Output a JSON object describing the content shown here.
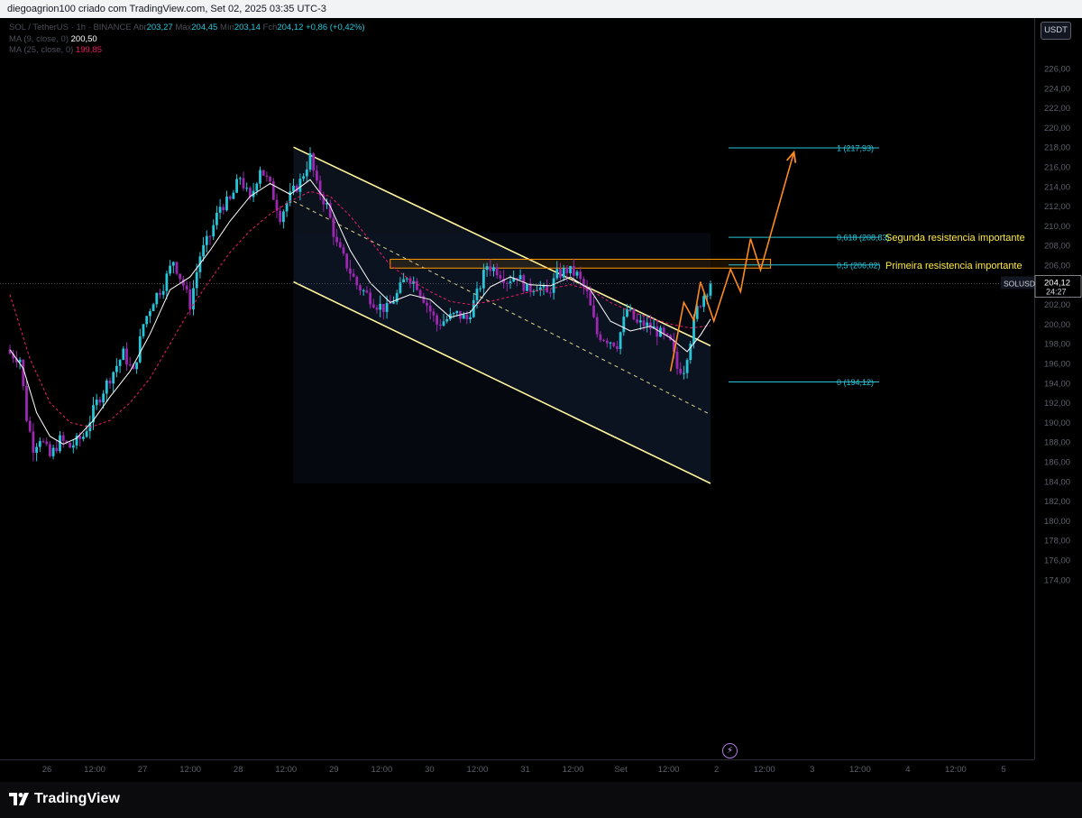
{
  "header": {
    "text": "diegoagrion100 criado com TradingView.com, Set 02, 2025 03:35 UTC-3"
  },
  "legend": {
    "symbol": "SOL / TetherUS · 1h · BINANCE",
    "o_label": "Abr",
    "o_value": "203,27",
    "h_label": "Máx",
    "h_value": "204,45",
    "l_label": "Mín",
    "l_value": "203,14",
    "c_label": "Fch",
    "c_value": "204,12",
    "change": "+0,86 (+0,42%)",
    "ma9_label": "MA (9, close, 0)",
    "ma9_value": "200,50",
    "ma25_label": "MA (25, close, 0)",
    "ma25_value": "199,85"
  },
  "currency_button": "USDT",
  "brand": {
    "name": "TradingView"
  },
  "chart_data": {
    "type": "candlestick",
    "symbol": "SOLUSDT",
    "timeframe": "1h",
    "x_ticks": [
      "26",
      "12:00",
      "27",
      "12:00",
      "28",
      "12:00",
      "29",
      "12:00",
      "30",
      "12:00",
      "31",
      "12:00",
      "Set",
      "12:00",
      "2",
      "12:00",
      "3",
      "12:00",
      "4",
      "12:00",
      "5"
    ],
    "y_ticks": [
      "226,00",
      "224,00",
      "222,00",
      "220,00",
      "218,00",
      "216,00",
      "214,00",
      "212,00",
      "210,00",
      "208,00",
      "206,00",
      "204,00",
      "202,00",
      "200,00",
      "198,00",
      "196,00",
      "194,00",
      "192,00",
      "190,00",
      "188,00",
      "186,00",
      "184,00",
      "182,00",
      "180,00",
      "178,00",
      "176,00",
      "174,00"
    ],
    "y_range": [
      172.5,
      227.5
    ],
    "last_price": {
      "label": "SOLUSDT",
      "value": "204,12",
      "countdown": "24:27",
      "price": 204.12
    },
    "colors": {
      "up": "#26c6da",
      "down": "#9c27b0",
      "ma9": "#ffffff",
      "ma25": "#e91e63",
      "channel": "#fff59d",
      "fib": "#26c6da",
      "projection": "#ff8a1f",
      "zone": "#ff9800",
      "annotation": "#ffeb3b"
    },
    "close_path": [
      [
        0,
        197.0
      ],
      [
        3,
        196.5
      ],
      [
        5,
        190.5
      ],
      [
        7,
        187.5
      ],
      [
        9,
        188.5
      ],
      [
        12,
        186.5
      ],
      [
        15,
        188.2
      ],
      [
        18,
        187.5
      ],
      [
        22,
        188.6
      ],
      [
        26,
        192.0
      ],
      [
        30,
        194.6
      ],
      [
        34,
        197.0
      ],
      [
        37,
        195.0
      ],
      [
        40,
        200.0
      ],
      [
        43,
        202.5
      ],
      [
        46,
        204.0
      ],
      [
        49,
        206.5
      ],
      [
        52,
        204.0
      ],
      [
        54,
        202.0
      ],
      [
        57,
        207.0
      ],
      [
        60,
        209.0
      ],
      [
        63,
        212.0
      ],
      [
        66,
        212.5
      ],
      [
        69,
        215.0
      ],
      [
        72,
        212.5
      ],
      [
        75,
        216.0
      ],
      [
        78,
        214.0
      ],
      [
        81,
        211.0
      ],
      [
        84,
        213.0
      ],
      [
        87,
        214.5
      ],
      [
        90,
        217.0
      ],
      [
        92,
        214.0
      ],
      [
        95,
        212.0
      ],
      [
        98,
        208.0
      ],
      [
        101,
        206.0
      ],
      [
        104,
        204.0
      ],
      [
        107,
        203.0
      ],
      [
        110,
        202.0
      ],
      [
        113,
        201.5
      ],
      [
        116,
        203.0
      ],
      [
        119,
        205.0
      ],
      [
        122,
        204.0
      ],
      [
        125,
        202.0
      ],
      [
        128,
        200.0
      ],
      [
        131,
        200.5
      ],
      [
        134,
        201.0
      ],
      [
        137,
        200.5
      ],
      [
        140,
        203.0
      ],
      [
        143,
        206.0
      ],
      [
        146,
        205.5
      ],
      [
        149,
        204.5
      ],
      [
        152,
        205.0
      ],
      [
        155,
        203.5
      ],
      [
        158,
        204.0
      ],
      [
        161,
        203.0
      ],
      [
        164,
        205.0
      ],
      [
        167,
        205.5
      ],
      [
        170,
        205.0
      ],
      [
        173,
        203.0
      ],
      [
        176,
        199.0
      ],
      [
        179,
        198.5
      ],
      [
        182,
        198.0
      ],
      [
        185,
        201.5
      ],
      [
        188,
        200.0
      ],
      [
        190,
        200.0
      ],
      [
        193,
        199.5
      ],
      [
        195,
        199.0
      ],
      [
        198,
        198.0
      ],
      [
        200,
        195.5
      ],
      [
        202,
        195.5
      ],
      [
        204,
        198.5
      ],
      [
        206,
        201.5
      ],
      [
        208,
        203.0
      ],
      [
        210,
        204.1
      ]
    ],
    "ma9": [
      [
        0,
        197.4
      ],
      [
        4,
        195.5
      ],
      [
        8,
        191.0
      ],
      [
        12,
        188.6
      ],
      [
        16,
        187.8
      ],
      [
        20,
        188.4
      ],
      [
        25,
        190.2
      ],
      [
        30,
        192.6
      ],
      [
        36,
        195.2
      ],
      [
        42,
        199.0
      ],
      [
        48,
        203.5
      ],
      [
        54,
        204.8
      ],
      [
        60,
        207.5
      ],
      [
        66,
        210.5
      ],
      [
        72,
        213.0
      ],
      [
        78,
        214.3
      ],
      [
        84,
        213.2
      ],
      [
        90,
        214.7
      ],
      [
        96,
        212.0
      ],
      [
        102,
        207.5
      ],
      [
        108,
        204.2
      ],
      [
        114,
        202.2
      ],
      [
        120,
        203.0
      ],
      [
        126,
        202.5
      ],
      [
        132,
        200.7
      ],
      [
        138,
        201.2
      ],
      [
        144,
        203.8
      ],
      [
        150,
        204.8
      ],
      [
        156,
        204.0
      ],
      [
        162,
        203.9
      ],
      [
        168,
        204.8
      ],
      [
        174,
        203.5
      ],
      [
        180,
        200.3
      ],
      [
        186,
        199.3
      ],
      [
        192,
        199.8
      ],
      [
        198,
        198.6
      ],
      [
        203,
        197.2
      ],
      [
        207,
        198.9
      ],
      [
        210,
        200.5
      ]
    ],
    "ma25": [
      [
        0,
        203.0
      ],
      [
        6,
        196.5
      ],
      [
        12,
        192.0
      ],
      [
        18,
        190.0
      ],
      [
        24,
        189.5
      ],
      [
        30,
        190.2
      ],
      [
        36,
        192.0
      ],
      [
        42,
        194.5
      ],
      [
        48,
        198.0
      ],
      [
        54,
        201.5
      ],
      [
        60,
        204.5
      ],
      [
        66,
        207.3
      ],
      [
        72,
        209.5
      ],
      [
        78,
        211.2
      ],
      [
        84,
        212.5
      ],
      [
        90,
        213.5
      ],
      [
        96,
        213.0
      ],
      [
        102,
        211.0
      ],
      [
        108,
        208.5
      ],
      [
        114,
        206.0
      ],
      [
        120,
        204.5
      ],
      [
        126,
        203.3
      ],
      [
        132,
        202.3
      ],
      [
        138,
        202.0
      ],
      [
        144,
        202.3
      ],
      [
        150,
        202.8
      ],
      [
        156,
        203.3
      ],
      [
        162,
        203.6
      ],
      [
        168,
        204.0
      ],
      [
        174,
        203.5
      ],
      [
        180,
        202.2
      ],
      [
        186,
        201.3
      ],
      [
        192,
        200.6
      ],
      [
        198,
        200.0
      ],
      [
        204,
        199.6
      ],
      [
        210,
        199.85
      ]
    ],
    "channel": {
      "upper": [
        [
          85,
          218.0
        ],
        [
          210,
          197.8
        ]
      ],
      "middle": [
        [
          85,
          212.5
        ],
        [
          210,
          190.8
        ]
      ],
      "lower": [
        [
          85,
          204.3
        ],
        [
          210,
          183.8
        ]
      ],
      "fill_range": [
        85,
        210
      ]
    },
    "fibonacci": {
      "levels": [
        {
          "ratio": "1",
          "price": 217.93,
          "label": "1 (217,93)"
        },
        {
          "ratio": "0,618",
          "price": 208.83,
          "label": "0,618 (208,83)"
        },
        {
          "ratio": "0,5",
          "price": 206.02,
          "label": "0,5 (206,02)"
        },
        {
          "ratio": "0",
          "price": 194.12,
          "label": "0 (194,12)"
        }
      ]
    },
    "resistance_zone": {
      "from": 205.7,
      "to": 206.6,
      "x_start": 114,
      "x_end": 228
    },
    "annotations": [
      {
        "text": "Segunda resistencia importante",
        "price": 208.83
      },
      {
        "text": "Primeira resistencia importante",
        "price": 206.02
      }
    ],
    "projection": [
      [
        198,
        195.2
      ],
      [
        202,
        202.2
      ],
      [
        205,
        200.4
      ],
      [
        207,
        204.3
      ],
      [
        211,
        200.3
      ],
      [
        216,
        205.6
      ],
      [
        219,
        203.3
      ],
      [
        222,
        208.7
      ],
      [
        225,
        205.5
      ],
      [
        235,
        217.5
      ]
    ]
  }
}
